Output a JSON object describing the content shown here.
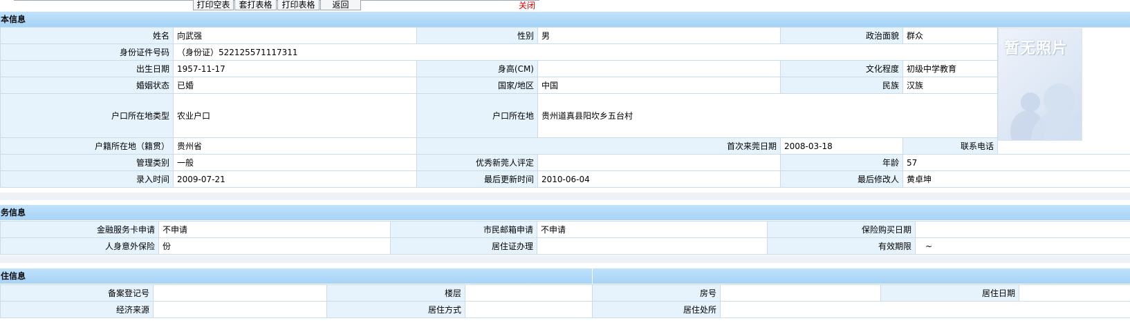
{
  "toolbar": {
    "buttons": [
      "打印空表",
      "套打表格",
      "打印表格",
      "返回"
    ],
    "close": "关闭"
  },
  "basic": {
    "title": "本信息",
    "name_label": "姓名",
    "name": "向武强",
    "gender_label": "性别",
    "gender": "男",
    "politics_label": "政治面貌",
    "politics": "群众",
    "id_label": "身份证件号码",
    "id": "（身份证）522125571117311",
    "birth_label": "出生日期",
    "birth": "1957-11-17",
    "height_label": "身高(CM)",
    "height": "",
    "edu_label": "文化程度",
    "edu": "初级中学教育",
    "marital_label": "婚姻状态",
    "marital": "已婚",
    "country_label": "国家/地区",
    "country": "中国",
    "ethnic_label": "民族",
    "ethnic": "汉族",
    "hukou_type_label": "户口所在地类型",
    "hukou_type": "农业户口",
    "hukou_loc_label": "户口所在地",
    "hukou_loc": "贵州道真县阳坎乡五台村",
    "origin_label": "户籍所在地（籍贯）",
    "origin": "贵州省",
    "first_date_label": "首次来莞日期",
    "first_date": "2008-03-18",
    "phone_label": "联系电话",
    "phone": "",
    "mgmt_label": "管理类别",
    "mgmt": "一般",
    "excellent_label": "优秀新莞人评定",
    "excellent": "",
    "age_label": "年龄",
    "age": "57",
    "entry_label": "录入时间",
    "entry": "2009-07-21",
    "updated_label": "最后更新时间",
    "updated": "2010-06-04",
    "modifier_label": "最后修改人",
    "modifier": "黄卓坤",
    "photo_text": "暂无照片"
  },
  "service": {
    "title": "务信息",
    "card_label": "金融服务卡申请",
    "card": "不申请",
    "mail_label": "市民邮箱申请",
    "mail": "不申请",
    "insdate_label": "保险购买日期",
    "insdate": "",
    "accident_label": "人身意外保险",
    "accident": "份",
    "permit_label": "居住证办理",
    "permit": "",
    "validity_label": "有效期限",
    "validity": "~"
  },
  "residence": {
    "title": "住信息",
    "reg_label": "备案登记号",
    "reg": "",
    "floor_label": "楼层",
    "floor": "",
    "room_label": "房号",
    "room": "",
    "resdate_label": "居住日期",
    "resdate": "",
    "income_label": "经济来源",
    "income": "",
    "method_label": "居住方式",
    "method": "",
    "place_label": "居住处所",
    "place": ""
  }
}
